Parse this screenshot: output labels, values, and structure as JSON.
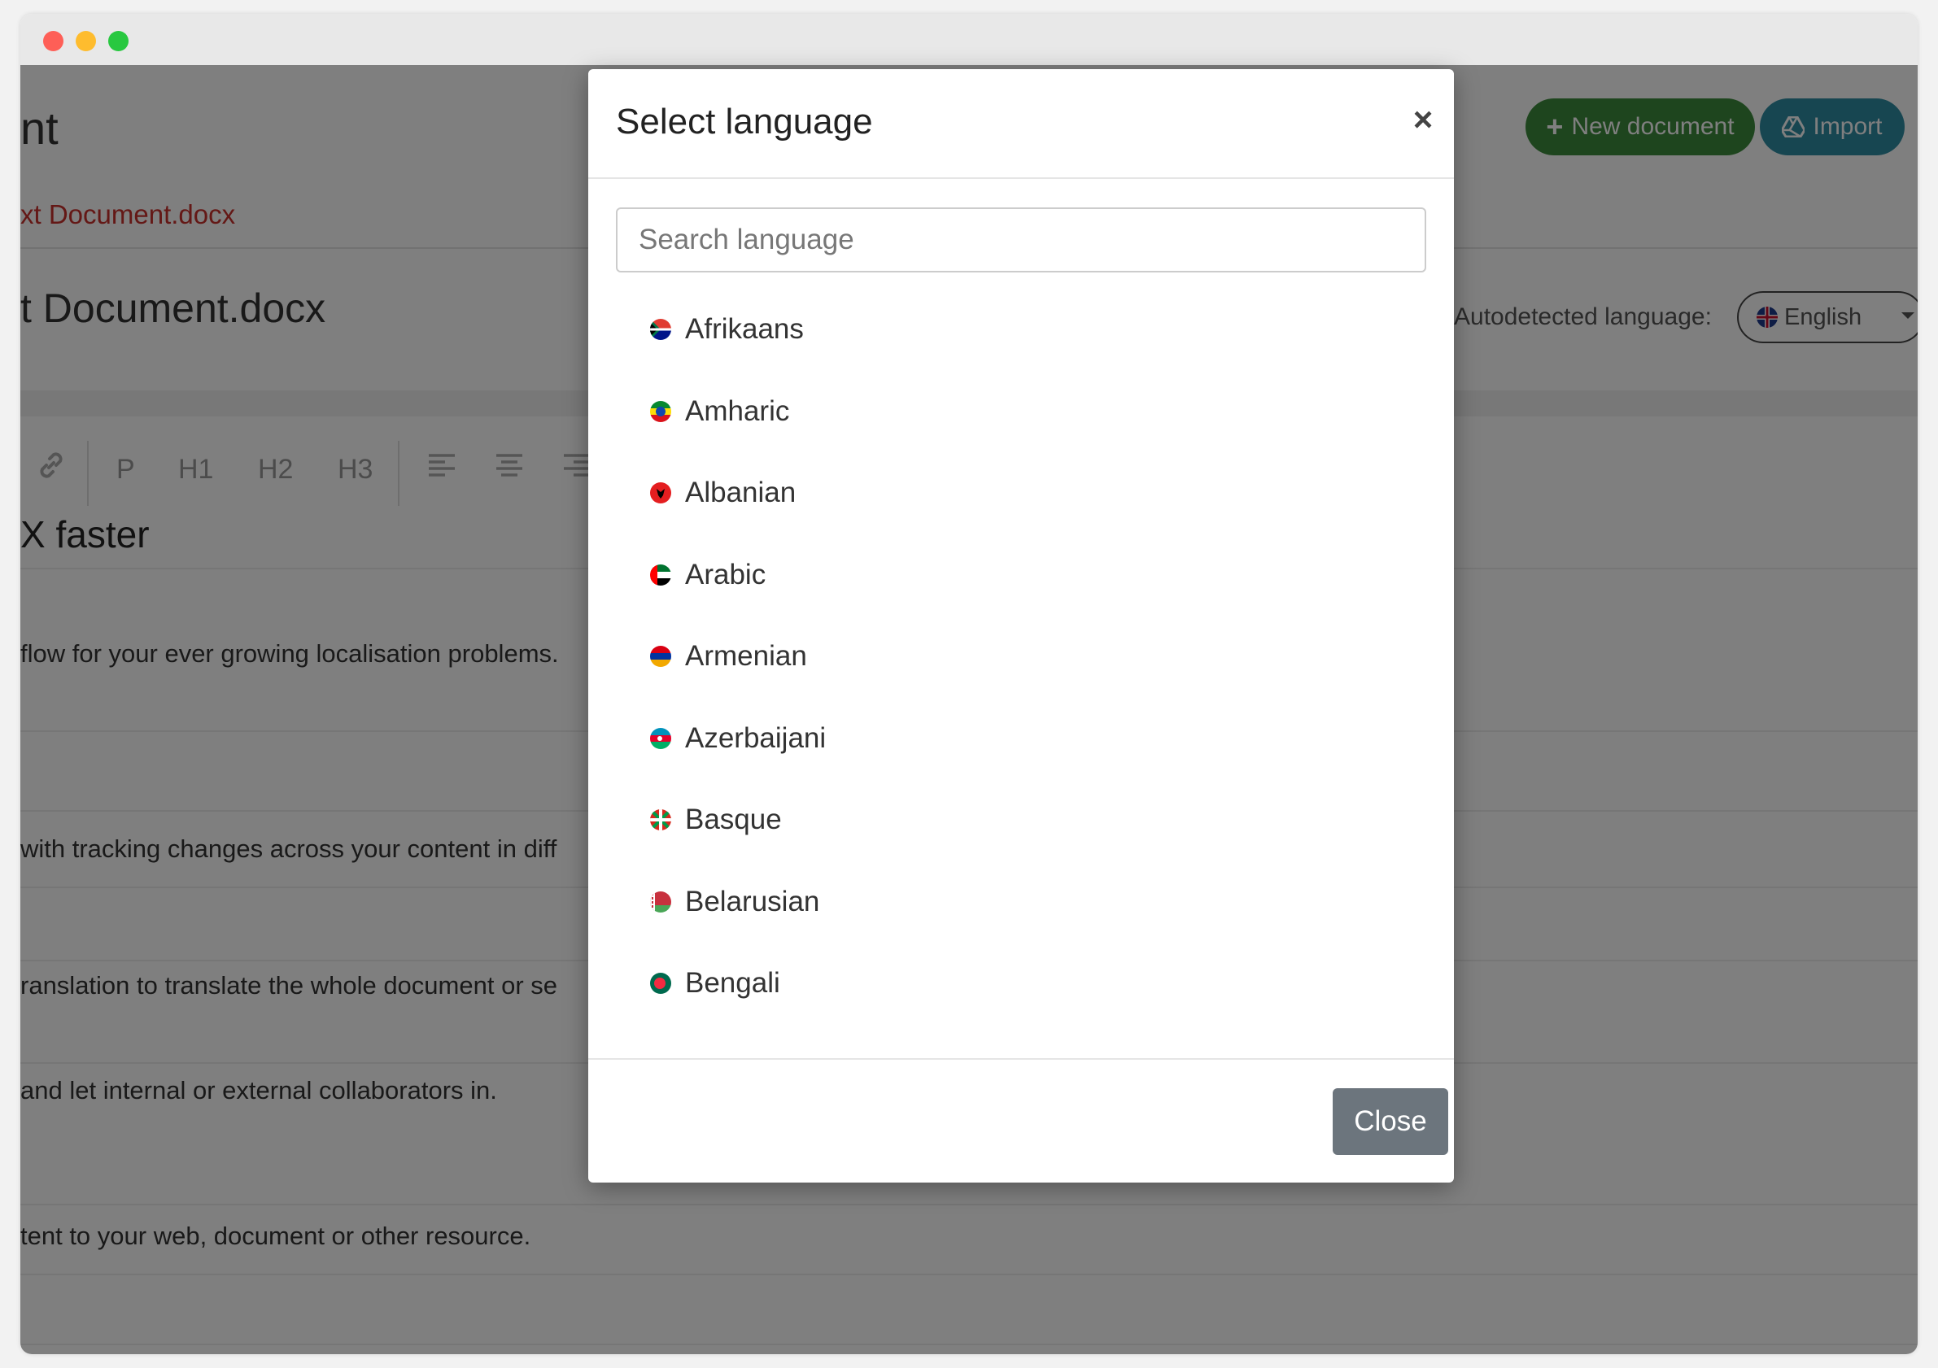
{
  "window": {
    "controls": [
      "close",
      "minimize",
      "maximize"
    ]
  },
  "header": {
    "title_partial": "nt",
    "file_link": "xt Document.docx",
    "new_document_label": "New document",
    "import_label": "Import"
  },
  "document": {
    "title_partial": "t Document.docx",
    "autodetected_label": "Autodetected language:",
    "detected_language": "English",
    "toolbar": [
      "P",
      "H1",
      "H2",
      "H3"
    ],
    "heading_partial": "X faster",
    "paragraphs": [
      "flow for your ever growing localisation problems.",
      " with tracking changes across your content in diff",
      "ranslation to translate the whole document or se",
      " and let internal or external collaborators in.",
      "tent to your web, document or other resource."
    ]
  },
  "modal": {
    "title": "Select language",
    "search_placeholder": "Search language",
    "languages": [
      {
        "name": "Afrikaans",
        "flag": "za-flag"
      },
      {
        "name": "Amharic",
        "flag": "et-flag"
      },
      {
        "name": "Albanian",
        "flag": "al-flag"
      },
      {
        "name": "Arabic",
        "flag": "ae-flag"
      },
      {
        "name": "Armenian",
        "flag": "am-flag"
      },
      {
        "name": "Azerbaijani",
        "flag": "az-flag"
      },
      {
        "name": "Basque",
        "flag": "eu-flag"
      },
      {
        "name": "Belarusian",
        "flag": "by-flag"
      },
      {
        "name": "Bengali",
        "flag": "bd-flag"
      }
    ],
    "close_label": "Close"
  },
  "colors": {
    "new_document": "#3c8b3c",
    "import": "#2f8ca3",
    "file_link": "#c9302c",
    "close_button": "#6c757d",
    "overlay": "rgba(0,0,0,0.5)"
  }
}
